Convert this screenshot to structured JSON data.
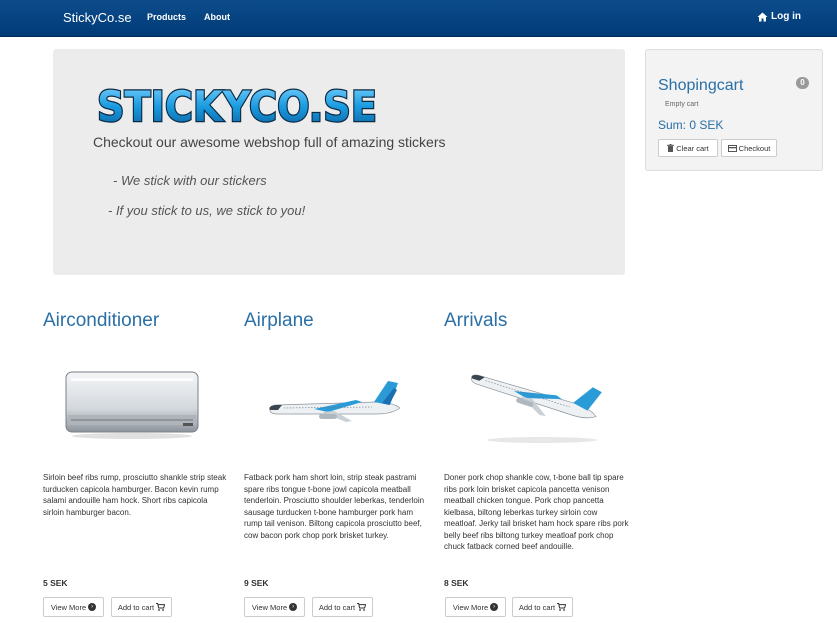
{
  "nav": {
    "brand": "StickyCo.se",
    "links": [
      "Products",
      "About"
    ],
    "login": "Log in"
  },
  "hero": {
    "logo_text": "STICKYCO.SE",
    "tagline": "Checkout our awesome webshop full of amazing stickers",
    "quote1": "- We stick with our stickers",
    "quote2": "- If you stick to us, we stick to you!"
  },
  "cart": {
    "title": "Shopingcart",
    "count": "0",
    "empty_text": "Empty cart",
    "sum": "Sum: 0 SEK",
    "clear_label": "Clear cart",
    "checkout_label": "Checkout"
  },
  "products": [
    {
      "title": "Airconditioner",
      "desc": "Sirloin beef ribs rump, prosciutto shankle strip steak turducken capicola hamburger. Bacon kevin rump salami andouille ham hock. Short ribs capicola sirloin hamburger bacon.",
      "price": "5 SEK",
      "view_label": "View More",
      "add_label": "Add to cart"
    },
    {
      "title": "Airplane",
      "desc": "Fatback pork ham short loin, strip steak pastrami spare ribs tongue t-bone jowl capicola meatball tenderloin. Prosciutto shoulder leberkas, tenderloin sausage turducken t-bone hamburger pork ham rump tail venison. Biltong capicola prosciutto beef, cow bacon pork chop pork brisket turkey.",
      "price": "9 SEK",
      "view_label": "View More",
      "add_label": "Add to cart"
    },
    {
      "title": "Arrivals",
      "desc": "Doner pork chop shankle cow, t-bone ball tip spare ribs pork loin brisket capicola pancetta venison meatball chicken tongue. Pork chop pancetta kielbasa, biltong leberkas turkey sirloin cow meatloaf. Jerky tail brisket ham hock spare ribs pork belly beef ribs biltong turkey meatloaf pork chop chuck fatback corned beef andouille.",
      "price": "8 SEK",
      "view_label": "View More",
      "add_label": "Add to cart"
    }
  ]
}
